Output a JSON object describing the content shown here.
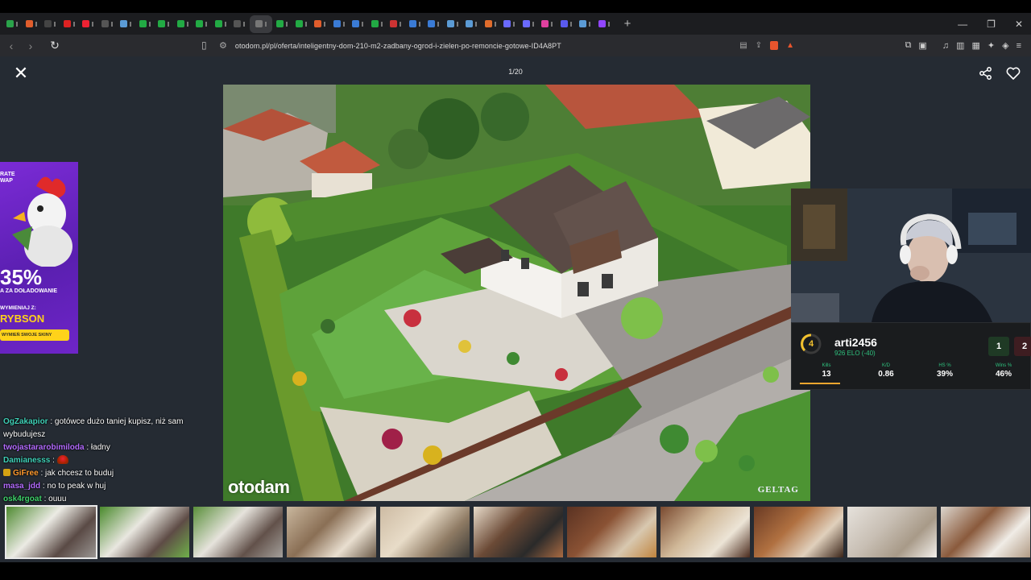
{
  "browser": {
    "tab_colors": [
      "#2aa34a",
      "#e05d2c",
      "#444",
      "#d22",
      "#e23",
      "#555",
      "#5b9bd5",
      "#22aa44",
      "#22aa44",
      "#22aa44",
      "#22aa44",
      "#22aa44",
      "#555",
      "#777",
      "#22aa44",
      "#22aa44",
      "#e05d2c",
      "#3a7bd5",
      "#3a7bd5",
      "#22aa44",
      "#c33",
      "#3a7bd5",
      "#3a7bd5",
      "#5b9bd5",
      "#5b9bd5",
      "#e06c2c",
      "#6a6aff",
      "#6a6aff",
      "#e0409f",
      "#5a5aee",
      "#5b9bd5",
      "#9146ff"
    ],
    "url": "otodom.pl/pl/oferta/inteligentny-dom-210-m2-zadbany-ogrod-i-zielen-po-remoncie-gotowe-ID4A8PT"
  },
  "gallery": {
    "counter": "1/20",
    "watermark": "otodam",
    "photo_credit": "GELTAG",
    "thumbnails": [
      {
        "kind": "aerial",
        "selected": true
      },
      {
        "kind": "aerial2",
        "selected": false
      },
      {
        "kind": "aerial3",
        "selected": false
      },
      {
        "kind": "living",
        "selected": false
      },
      {
        "kind": "living2",
        "selected": false
      },
      {
        "kind": "tv",
        "selected": false
      },
      {
        "kind": "kitchen",
        "selected": false
      },
      {
        "kind": "kitchen2",
        "selected": false
      },
      {
        "kind": "kitchen3",
        "selected": false
      },
      {
        "kind": "bath",
        "selected": false
      },
      {
        "kind": "bath2",
        "selected": false
      }
    ]
  },
  "ad": {
    "top_line1": "RATE",
    "top_line2": "WAP",
    "percent": "35%",
    "subtitle": "A ZA DOŁADOWANIE",
    "sub2": "WYMIENIAJ Z:",
    "brand": "RYBSON",
    "cta": "WYMIEŃ SWOJE SKINY"
  },
  "chat": [
    {
      "user": "OgZakapior",
      "color": "#3fd1b8",
      "text": " : gotówce dużo taniej kupisz, niż sam wybudujesz"
    },
    {
      "user": "twojastararobimiloda",
      "color": "#b36bff",
      "text": " : ładny"
    },
    {
      "user": "Damianesss",
      "color": "#3fd1b8",
      "text": " : "
    },
    {
      "user": "GiFree",
      "color": "#ff9a2e",
      "text": " : jak chcesz to buduj"
    },
    {
      "user": "masa_jdd",
      "color": "#b36bff",
      "text": " : no to peak w huj"
    },
    {
      "user": "osk4rgoat",
      "color": "#3fd16b",
      "text": " : ouuu"
    }
  ],
  "faceit": {
    "level": "4",
    "name": "arti2456",
    "elo": "926 ELO (-40)",
    "wins_streak": "1",
    "loss_streak": "2",
    "stats": [
      {
        "label": "Kills",
        "value": "13"
      },
      {
        "label": "K/D",
        "value": "0.86"
      },
      {
        "label": "HS %",
        "value": "39%"
      },
      {
        "label": "Wins %",
        "value": "46%"
      }
    ]
  }
}
